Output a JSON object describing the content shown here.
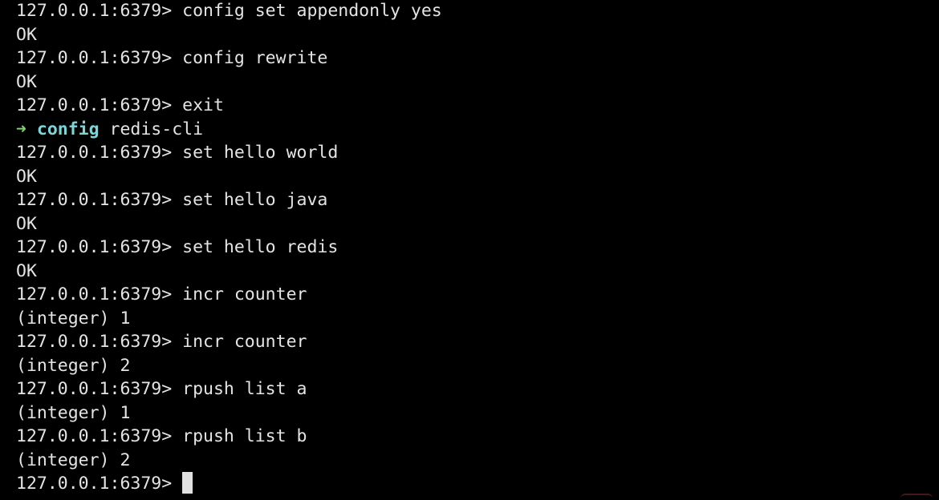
{
  "terminal": {
    "prompt": "127.0.0.1:6379>",
    "lines": [
      {
        "kind": "cmd",
        "text": "config set appendonly yes"
      },
      {
        "kind": "out",
        "text": "OK"
      },
      {
        "kind": "cmd",
        "text": "config rewrite"
      },
      {
        "kind": "out",
        "text": "OK"
      },
      {
        "kind": "cmd",
        "text": "exit"
      },
      {
        "kind": "shell",
        "arrow": "➜",
        "cwd": "config",
        "text": "redis-cli"
      },
      {
        "kind": "cmd",
        "text": "set hello world"
      },
      {
        "kind": "out",
        "text": "OK"
      },
      {
        "kind": "cmd",
        "text": "set hello java"
      },
      {
        "kind": "out",
        "text": "OK"
      },
      {
        "kind": "cmd",
        "text": "set hello redis"
      },
      {
        "kind": "out",
        "text": "OK"
      },
      {
        "kind": "cmd",
        "text": "incr counter"
      },
      {
        "kind": "out",
        "text": "(integer) 1"
      },
      {
        "kind": "cmd",
        "text": "incr counter"
      },
      {
        "kind": "out",
        "text": "(integer) 2"
      },
      {
        "kind": "cmd",
        "text": "rpush list a"
      },
      {
        "kind": "out",
        "text": "(integer) 1"
      },
      {
        "kind": "cmd",
        "text": "rpush list b"
      },
      {
        "kind": "out",
        "text": "(integer) 2"
      }
    ],
    "current_input": "",
    "colors": {
      "background": "#000000",
      "foreground": "#e4e4e4",
      "arrow": "#7ed36b",
      "cwd": "#79d7d9"
    }
  }
}
